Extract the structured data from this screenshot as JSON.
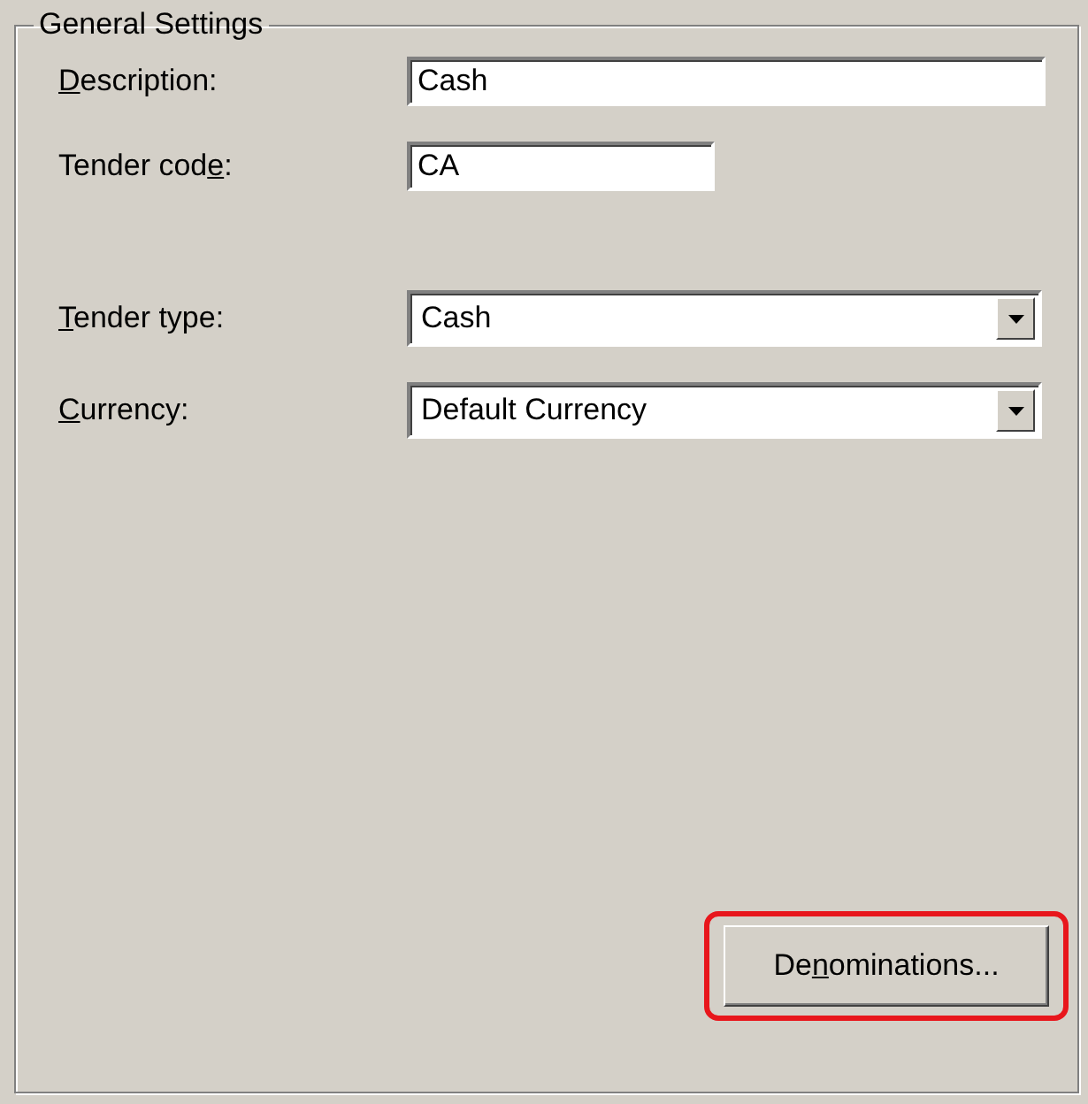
{
  "group": {
    "title": "General Settings",
    "fields": [
      {
        "kind": "text",
        "label": {
          "key": "D",
          "post": "escription:"
        },
        "value": "Cash",
        "wide": true
      },
      {
        "kind": "text",
        "label": {
          "pre": "Tender cod",
          "key": "e",
          "post": ":"
        },
        "value": "CA",
        "wide": false
      },
      {
        "kind": "dropdown",
        "label": {
          "key": "T",
          "post": "ender type:"
        },
        "value": "Cash",
        "wide": true
      },
      {
        "kind": "dropdown",
        "label": {
          "key": "C",
          "post": "urrency:"
        },
        "value": "Default Currency",
        "wide": true
      }
    ],
    "button": {
      "label": {
        "pre": "De",
        "key": "n",
        "post": "ominations..."
      },
      "highlighted": true
    }
  }
}
